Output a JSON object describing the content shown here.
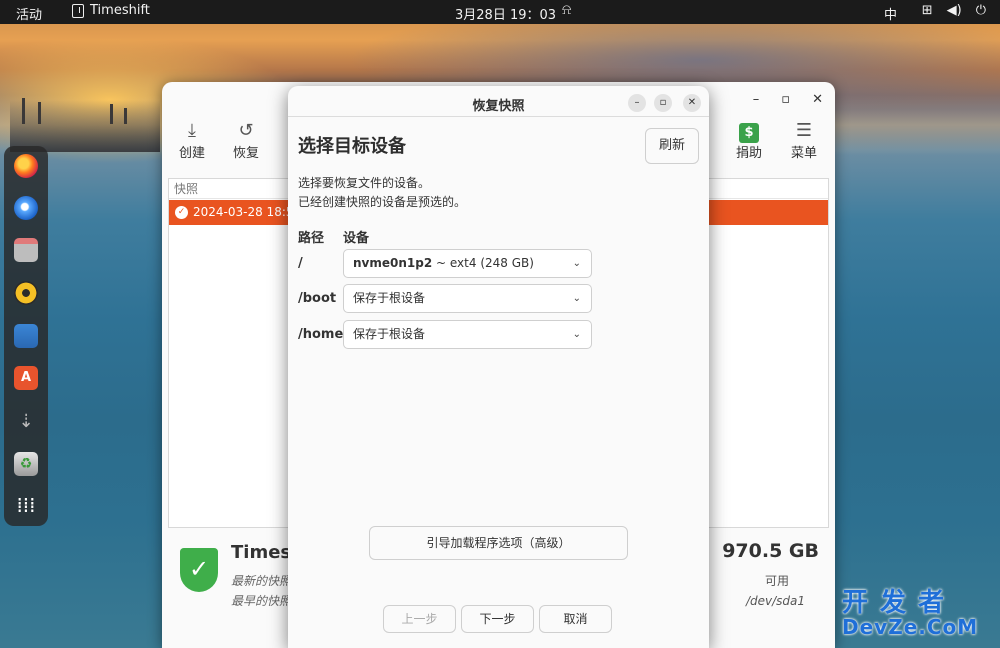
{
  "topbar": {
    "activities": "活动",
    "app_name": "Timeshift",
    "clock": "3月28日  19：03",
    "ime": "中"
  },
  "dock": {
    "items": [
      "firefox-icon",
      "thunderbird-icon",
      "files-icon",
      "rhythmbox-icon",
      "writer-icon",
      "app-center-icon",
      "usb-icon",
      "trash-icon",
      "show-apps-icon"
    ]
  },
  "main": {
    "toolbar": {
      "create": "创建",
      "restore": "恢复",
      "donate": "捐助",
      "menu": "菜单"
    },
    "snapshots_header": "快照",
    "snapshot_row": "2024-03-28 18:57:",
    "status": {
      "title": "Timesh",
      "latest": "最新的快照",
      "oldest": "最早的快照"
    },
    "disk": {
      "size": "970.5 GB",
      "label": "可用",
      "device": "/dev/sda1"
    }
  },
  "dialog": {
    "title": "恢复快照",
    "heading": "选择目标设备",
    "refresh": "刷新",
    "desc1": "选择要恢复文件的设备。",
    "desc2": "已经创建快照的设备是预选的。",
    "col_path": "路径",
    "col_device": "设备",
    "rows": [
      {
        "path": "/",
        "device_main": "nvme0n1p2",
        "device_detail": " ~ ext4 (248 GB)"
      },
      {
        "path": "/boot",
        "device_main": "保存于根设备",
        "device_detail": ""
      },
      {
        "path": "/home",
        "device_main": "保存于根设备",
        "device_detail": ""
      }
    ],
    "bootloader": "引导加载程序选项（高级）",
    "prev": "上一步",
    "next": "下一步",
    "cancel": "取消"
  },
  "watermark": {
    "line1": "开发者",
    "line2": "DevZe.CoM"
  },
  "colors": {
    "accent": "#e95420",
    "shield": "#3fae4a",
    "watermark": "#1f6fd8"
  }
}
